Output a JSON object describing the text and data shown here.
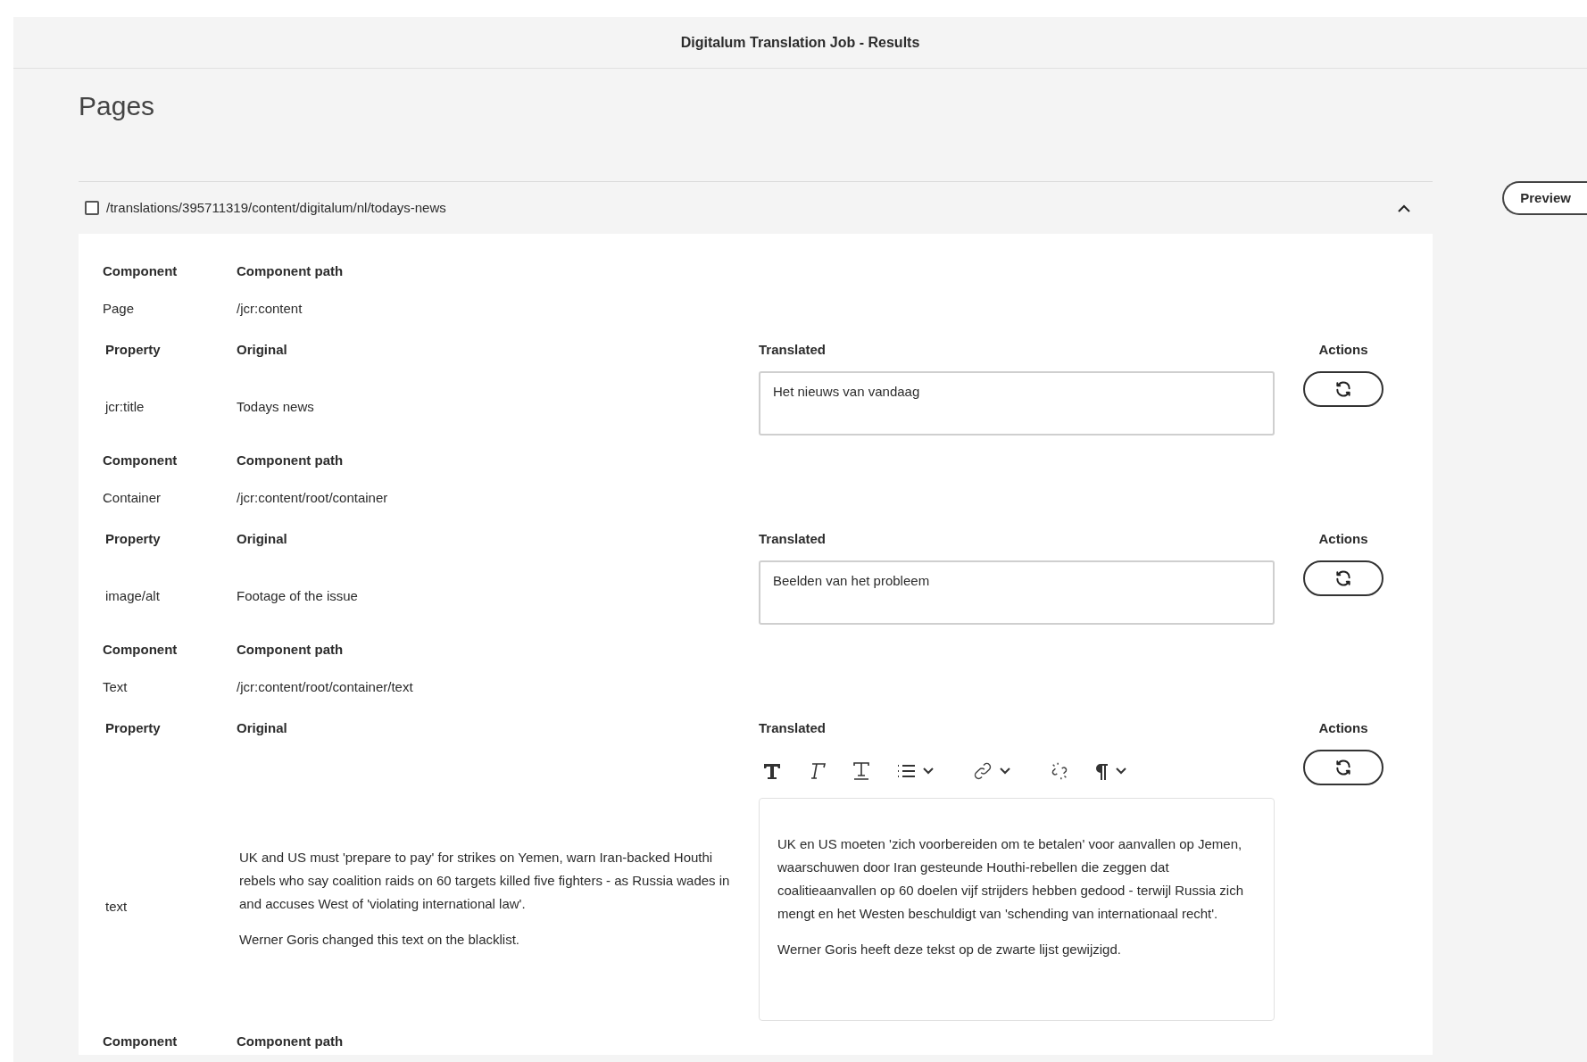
{
  "header": {
    "title": "Digitalum Translation Job - Results"
  },
  "page_title": "Pages",
  "page": {
    "path": "/translations/395711319/content/digitalum/nl/todays-news",
    "checked": false,
    "expanded": true,
    "preview_button": "Preview",
    "components": [
      {
        "kind": "plain",
        "component_heading": "Component",
        "component_path_heading": "Component path",
        "component": "Page",
        "component_path": "/jcr:content",
        "property_heading": "Property",
        "original_heading": "Original",
        "translated_heading": "Translated",
        "actions_heading": "Actions",
        "property": "jcr:title",
        "original": [
          "Todays news"
        ],
        "translated": [
          "Het nieuws van vandaag"
        ]
      },
      {
        "kind": "plain",
        "component_heading": "Component",
        "component_path_heading": "Component path",
        "component": "Container",
        "component_path": "/jcr:content/root/container",
        "property_heading": "Property",
        "original_heading": "Original",
        "translated_heading": "Translated",
        "actions_heading": "Actions",
        "property": "image/alt",
        "original": [
          "Footage of the issue"
        ],
        "translated": [
          "Beelden van het probleem"
        ]
      },
      {
        "kind": "rich",
        "component_heading": "Component",
        "component_path_heading": "Component path",
        "component": "Text",
        "component_path": "/jcr:content/root/container/text",
        "property_heading": "Property",
        "original_heading": "Original",
        "translated_heading": "Translated",
        "actions_heading": "Actions",
        "property": "text",
        "original": [
          "UK and US must 'prepare to pay' for strikes on Yemen, warn Iran-backed Houthi rebels who say coalition raids on 60 targets killed five fighters - as Russia wades in and accuses West of 'violating international law'.",
          "Werner Goris changed this text on  the blacklist."
        ],
        "translated": [
          "UK en US moeten 'zich voorbereiden om te betalen' voor aanvallen op Jemen, waarschuwen door Iran gesteunde Houthi-rebellen die zeggen dat coalitieaanvallen op 60 doelen vijf strijders hebben gedood - terwijl Russia zich mengt en het Westen beschuldigt van 'schending van internationaal recht'.",
          "Werner Goris heeft deze tekst op de zwarte lijst gewijzigd."
        ]
      }
    ],
    "next_component_heading": "Component",
    "next_component_path_heading": "Component path"
  }
}
